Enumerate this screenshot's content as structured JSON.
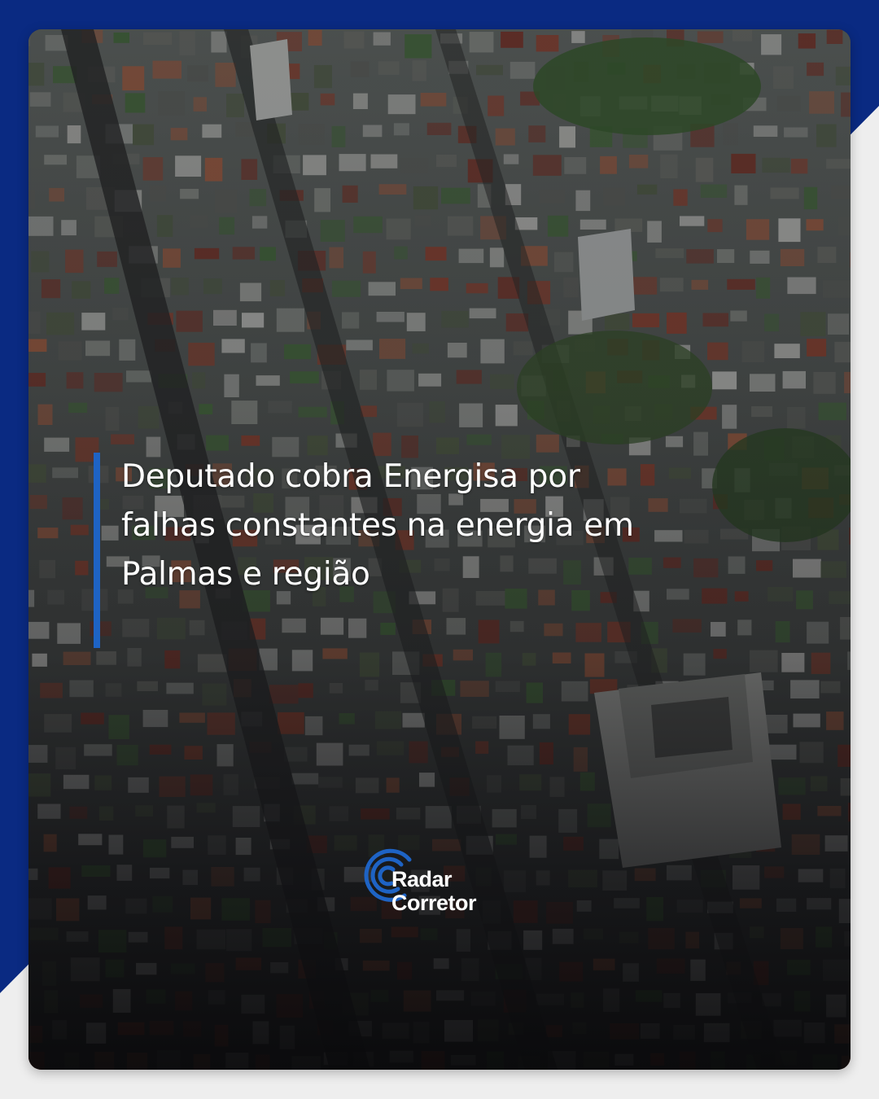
{
  "post": {
    "headline": "Deputado cobra Energisa por falhas constantes na energia em Palmas e região",
    "background_image": "aerial-city-photo",
    "accent_color": "#1e63c4",
    "frame_color": "#0a2a82"
  },
  "brand": {
    "logo_line1": "Radar",
    "logo_line2": "Corretor",
    "logo_icon": "radar-signal-icon"
  }
}
